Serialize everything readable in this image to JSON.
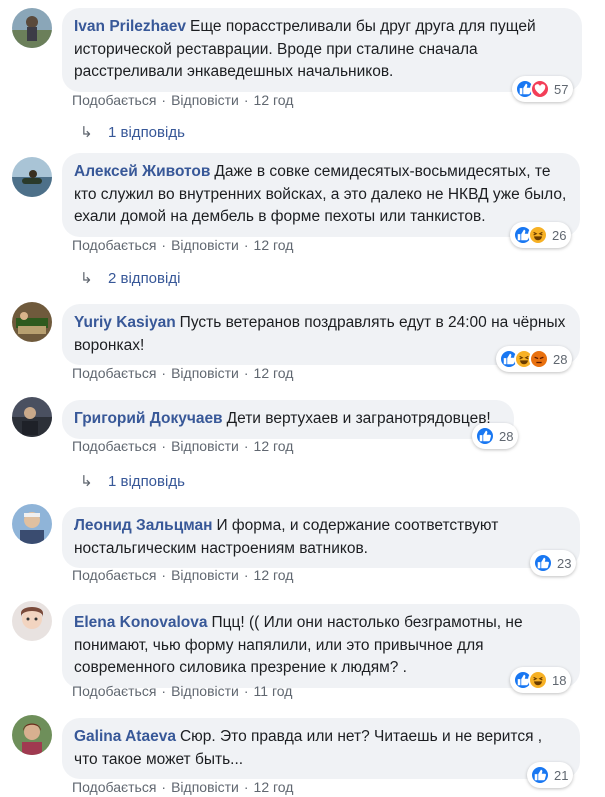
{
  "labels": {
    "like": "Подобається",
    "reply": "Відповісти"
  },
  "colors": {
    "name": "#385898",
    "bubble": "#f0f2f5",
    "meta": "#606770"
  },
  "comments": [
    {
      "author": "Ivan Prilezhaev",
      "text": "Еще порасстреливали бы друг друга для пущей исторической реставрации. Вроде при сталине сначала расстреливали энкаведешных начальников.",
      "time": "12 год",
      "reactions": [
        "like-icon",
        "love-icon"
      ],
      "count": "57",
      "replies": "1 відповідь"
    },
    {
      "author": "Алексей Животов",
      "text": "Даже в совке семидесятых-восьмидесятых, те кто служил во внутренних войсках, а это далеко не НКВД уже было, ехали домой на дембель в форме пехоты или танкистов.",
      "time": "12 год",
      "reactions": [
        "like-icon",
        "haha-icon"
      ],
      "count": "26",
      "replies": "2 відповіді"
    },
    {
      "author": "Yuriy Kasiyan",
      "text": "Пусть ветеранов поздравлять едут в 24:00 на чёрных воронках!",
      "time": "12 год",
      "reactions": [
        "like-icon",
        "haha-icon",
        "angry-icon"
      ],
      "count": "28",
      "replies": ""
    },
    {
      "author": "Григорий Докучаев",
      "text": "Дети вертухаев и загранотрядовцев!",
      "time": "12 год",
      "reactions": [
        "like-icon"
      ],
      "count": "28",
      "replies": "1 відповідь"
    },
    {
      "author": "Леонид Зальцман",
      "text": "И форма, и содержание соответствуют ностальгическим настроениям ватников.",
      "time": "12 год",
      "reactions": [
        "like-icon"
      ],
      "count": "23",
      "replies": ""
    },
    {
      "author": "Elena Konovalova",
      "text": "Пцц! (( Или они настолько безграмотны, не понимают, чью форму напялили, или это привычное для современного силовика презрение к людям? .",
      "time": "11 год",
      "reactions": [
        "like-icon",
        "haha-icon"
      ],
      "count": "18",
      "replies": ""
    },
    {
      "author": "Galina Ataeva",
      "text": "Сюр. Это правда или нет? Читаешь и не верится , что такое может быть...",
      "time": "12 год",
      "reactions": [
        "like-icon"
      ],
      "count": "21",
      "replies": ""
    }
  ]
}
